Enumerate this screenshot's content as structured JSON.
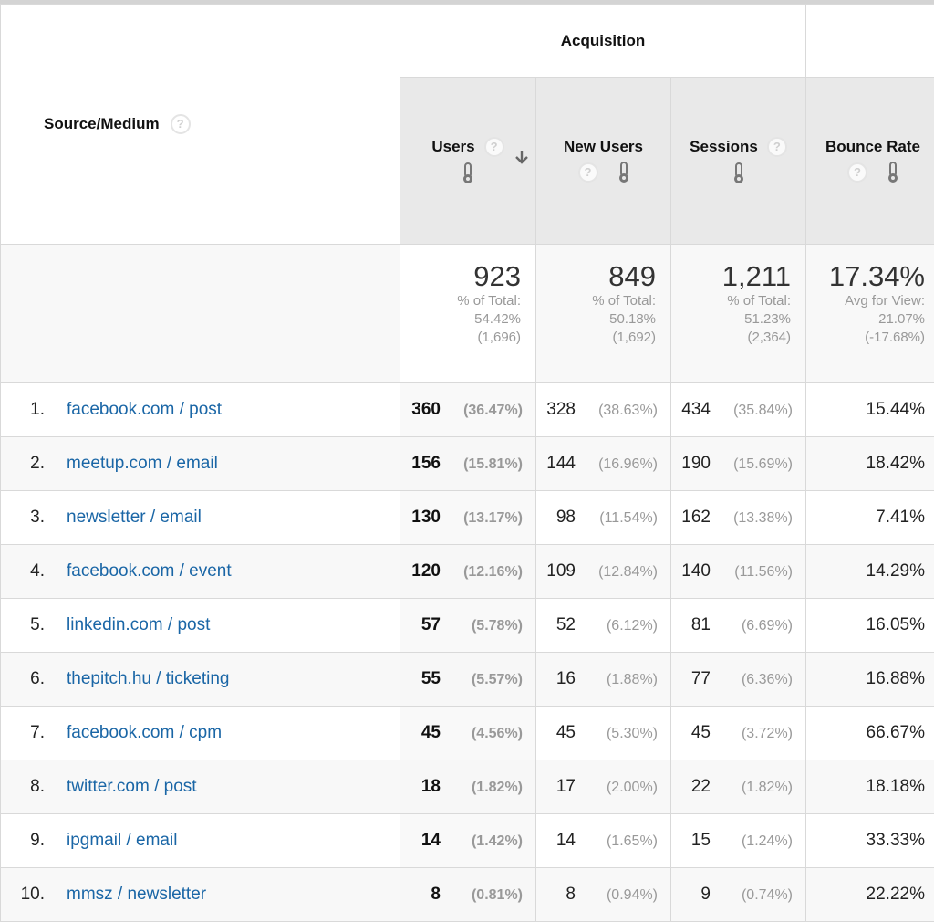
{
  "table": {
    "dimension_header": "Source/Medium",
    "group_header": "Acquisition",
    "columns": [
      {
        "key": "users",
        "label": "Users",
        "sorted": "descending"
      },
      {
        "key": "new_users",
        "label": "New Users"
      },
      {
        "key": "sessions",
        "label": "Sessions"
      },
      {
        "key": "bounce_rate",
        "label": "Bounce Rate"
      }
    ],
    "icons": {
      "help": "help-circle-icon",
      "heatmap": "thermometer-icon",
      "sort": "arrow-down-icon"
    },
    "summary": {
      "users": {
        "value": "923",
        "line1": "% of Total:",
        "line2": "54.42%",
        "line3": "(1,696)"
      },
      "new_users": {
        "value": "849",
        "line1": "% of Total:",
        "line2": "50.18%",
        "line3": "(1,692)"
      },
      "sessions": {
        "value": "1,211",
        "line1": "% of Total:",
        "line2": "51.23%",
        "line3": "(2,364)"
      },
      "bounce_rate": {
        "value": "17.34%",
        "line1": "Avg for View:",
        "line2": "21.07%",
        "line3": "(-17.68%)"
      }
    },
    "rows": [
      {
        "index": "1.",
        "source": "facebook.com / post",
        "users": "360",
        "users_pct": "(36.47%)",
        "new_users": "328",
        "new_users_pct": "(38.63%)",
        "sessions": "434",
        "sessions_pct": "(35.84%)",
        "bounce_rate": "15.44%"
      },
      {
        "index": "2.",
        "source": "meetup.com / email",
        "users": "156",
        "users_pct": "(15.81%)",
        "new_users": "144",
        "new_users_pct": "(16.96%)",
        "sessions": "190",
        "sessions_pct": "(15.69%)",
        "bounce_rate": "18.42%"
      },
      {
        "index": "3.",
        "source": "newsletter / email",
        "users": "130",
        "users_pct": "(13.17%)",
        "new_users": "98",
        "new_users_pct": "(11.54%)",
        "sessions": "162",
        "sessions_pct": "(13.38%)",
        "bounce_rate": "7.41%"
      },
      {
        "index": "4.",
        "source": "facebook.com / event",
        "users": "120",
        "users_pct": "(12.16%)",
        "new_users": "109",
        "new_users_pct": "(12.84%)",
        "sessions": "140",
        "sessions_pct": "(11.56%)",
        "bounce_rate": "14.29%"
      },
      {
        "index": "5.",
        "source": "linkedin.com / post",
        "users": "57",
        "users_pct": "(5.78%)",
        "new_users": "52",
        "new_users_pct": "(6.12%)",
        "sessions": "81",
        "sessions_pct": "(6.69%)",
        "bounce_rate": "16.05%"
      },
      {
        "index": "6.",
        "source": "thepitch.hu / ticketing",
        "users": "55",
        "users_pct": "(5.57%)",
        "new_users": "16",
        "new_users_pct": "(1.88%)",
        "sessions": "77",
        "sessions_pct": "(6.36%)",
        "bounce_rate": "16.88%"
      },
      {
        "index": "7.",
        "source": "facebook.com / cpm",
        "users": "45",
        "users_pct": "(4.56%)",
        "new_users": "45",
        "new_users_pct": "(5.30%)",
        "sessions": "45",
        "sessions_pct": "(3.72%)",
        "bounce_rate": "66.67%"
      },
      {
        "index": "8.",
        "source": "twitter.com / post",
        "users": "18",
        "users_pct": "(1.82%)",
        "new_users": "17",
        "new_users_pct": "(2.00%)",
        "sessions": "22",
        "sessions_pct": "(1.82%)",
        "bounce_rate": "18.18%"
      },
      {
        "index": "9.",
        "source": "ipgmail / email",
        "users": "14",
        "users_pct": "(1.42%)",
        "new_users": "14",
        "new_users_pct": "(1.65%)",
        "sessions": "15",
        "sessions_pct": "(1.24%)",
        "bounce_rate": "33.33%"
      },
      {
        "index": "10.",
        "source": "mmsz / newsletter",
        "users": "8",
        "users_pct": "(0.81%)",
        "new_users": "8",
        "new_users_pct": "(0.94%)",
        "sessions": "9",
        "sessions_pct": "(0.74%)",
        "bounce_rate": "22.22%"
      }
    ]
  },
  "colors": {
    "link": "#1a66a6",
    "header_bg": "#e9e9e9",
    "muted_text": "#999999"
  }
}
